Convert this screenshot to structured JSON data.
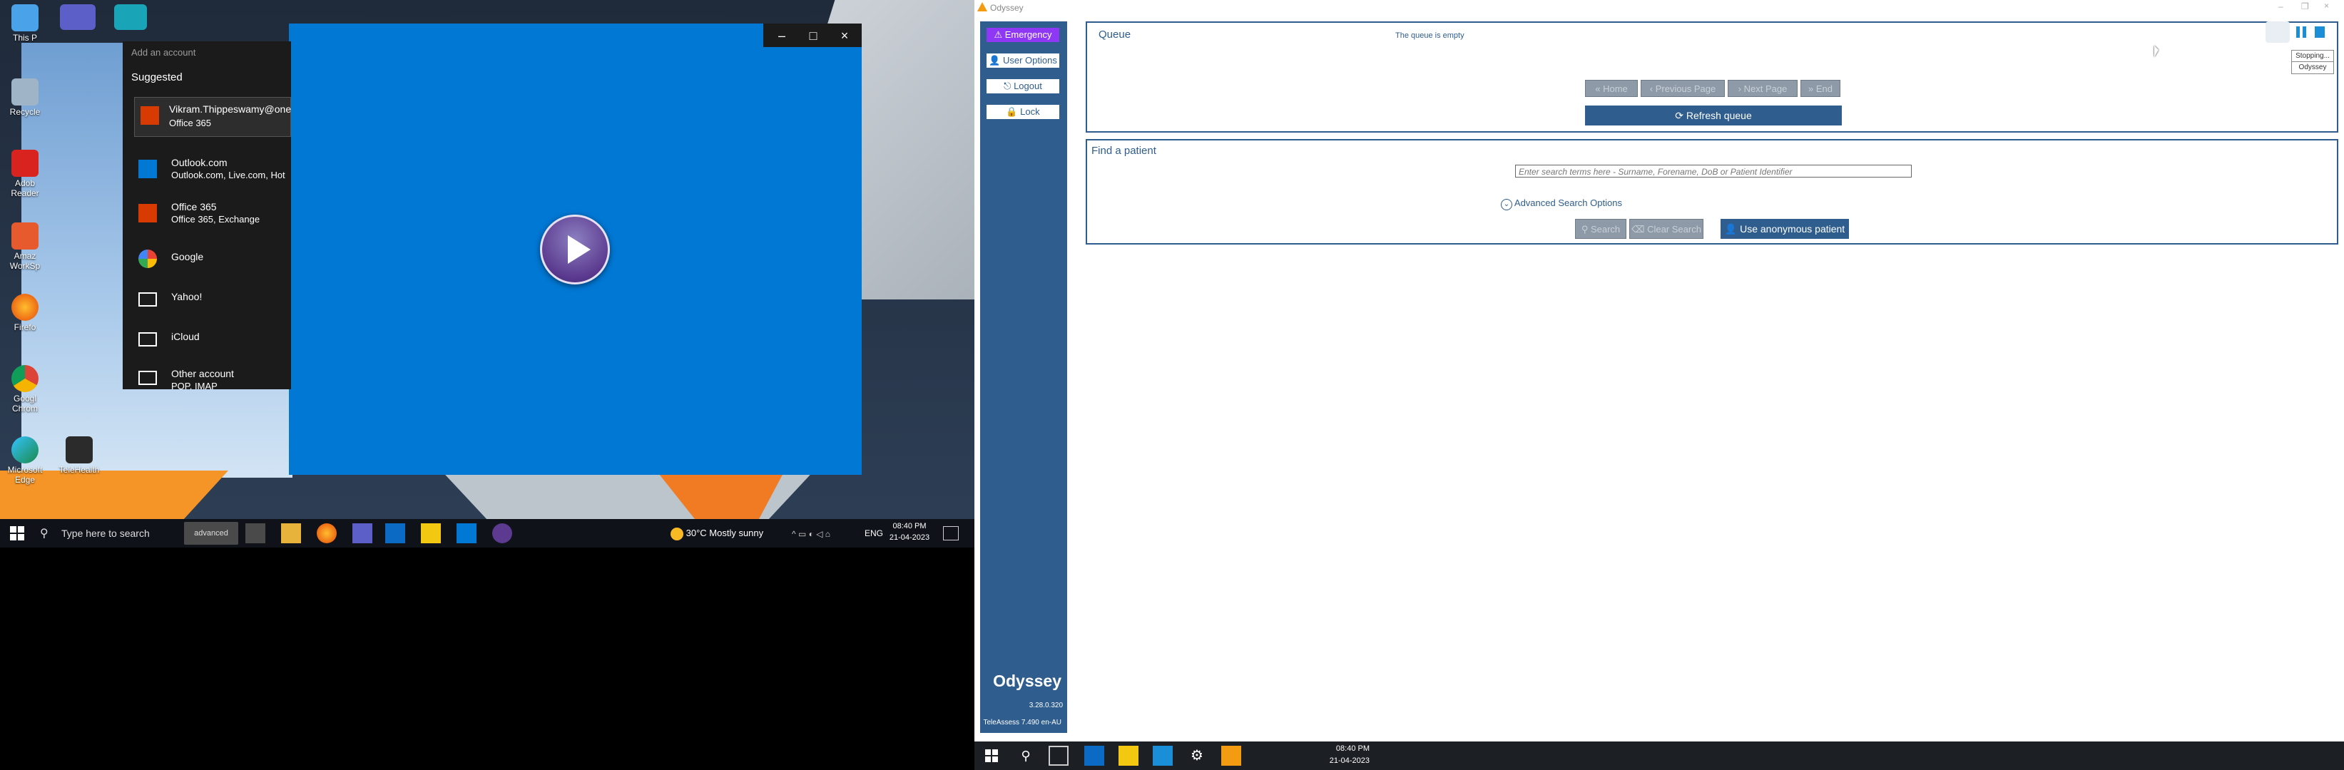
{
  "left_desktop": {
    "icons": [
      {
        "label": "This P",
        "name": "this-pc-icon"
      },
      {
        "label": "Recycle",
        "name": "recycle-bin-icon"
      },
      {
        "label": "Adob Reader",
        "name": "adobe-reader-icon"
      },
      {
        "label": "Amaz WorkSp",
        "name": "amazon-workspaces-icon"
      },
      {
        "label": "Firefo",
        "name": "firefox-icon"
      },
      {
        "label": "Googl Chrom",
        "name": "google-chrome-icon"
      },
      {
        "label": "Microsoft Edge",
        "name": "microsoft-edge-icon"
      },
      {
        "label": "TeleHealth",
        "name": "telehealth-icon"
      }
    ]
  },
  "add_account": {
    "header": "Add an account",
    "suggested": "Suggested",
    "items": [
      {
        "title": "Vikram.Thippeswamy@one",
        "subtitle": "Office 365",
        "icon": "office-icon"
      },
      {
        "title": "Outlook.com",
        "subtitle": "Outlook.com, Live.com, Hot",
        "icon": "outlook-icon"
      },
      {
        "title": "Office 365",
        "subtitle": "Office 365, Exchange",
        "icon": "office-icon"
      },
      {
        "title": "Google",
        "subtitle": "",
        "icon": "google-icon"
      },
      {
        "title": "Yahoo!",
        "subtitle": "",
        "icon": "mail-icon"
      },
      {
        "title": "iCloud",
        "subtitle": "",
        "icon": "mail-icon"
      },
      {
        "title": "Other account",
        "subtitle": "POP, IMAP",
        "icon": "mail-icon"
      }
    ]
  },
  "left_taskbar": {
    "search_placeholder": "Type here to search",
    "advanced_label": "advanced",
    "weather": "30°C  Mostly sunny",
    "language": "ENG",
    "time": "08:40 PM",
    "date": "21-04-2023"
  },
  "odyssey": {
    "window_title": "Odyssey",
    "sidebar": {
      "emergency": "Emergency",
      "user_options": "User Options",
      "logout": "Logout",
      "lock": "Lock",
      "brand": "Odyssey",
      "version": "3.28.0.320",
      "teleassess": "TeleAssess 7.490 en-AU"
    },
    "queue": {
      "title": "Queue",
      "empty_text": "The queue is empty",
      "home": "Home",
      "previous": "Previous Page",
      "next": "Next Page",
      "end": "End",
      "refresh": "Refresh queue"
    },
    "find": {
      "title": "Find a patient",
      "search_placeholder": "Enter search terms here - Surname, Forename, DoB or Patient Identifier",
      "advanced": "Advanced Search Options",
      "search": "Search",
      "clear": "Clear Search",
      "anonymous": "Use anonymous patient"
    },
    "overlay": {
      "stopping": "Stopping...",
      "odyssey": "Odyssey"
    }
  },
  "right_taskbar": {
    "time": "08:40 PM",
    "date": "21-04-2023"
  },
  "colors": {
    "odyssey_blue": "#2e5d8e",
    "emergency_purple": "#8e37f5",
    "video_blue": "#0078d4"
  }
}
